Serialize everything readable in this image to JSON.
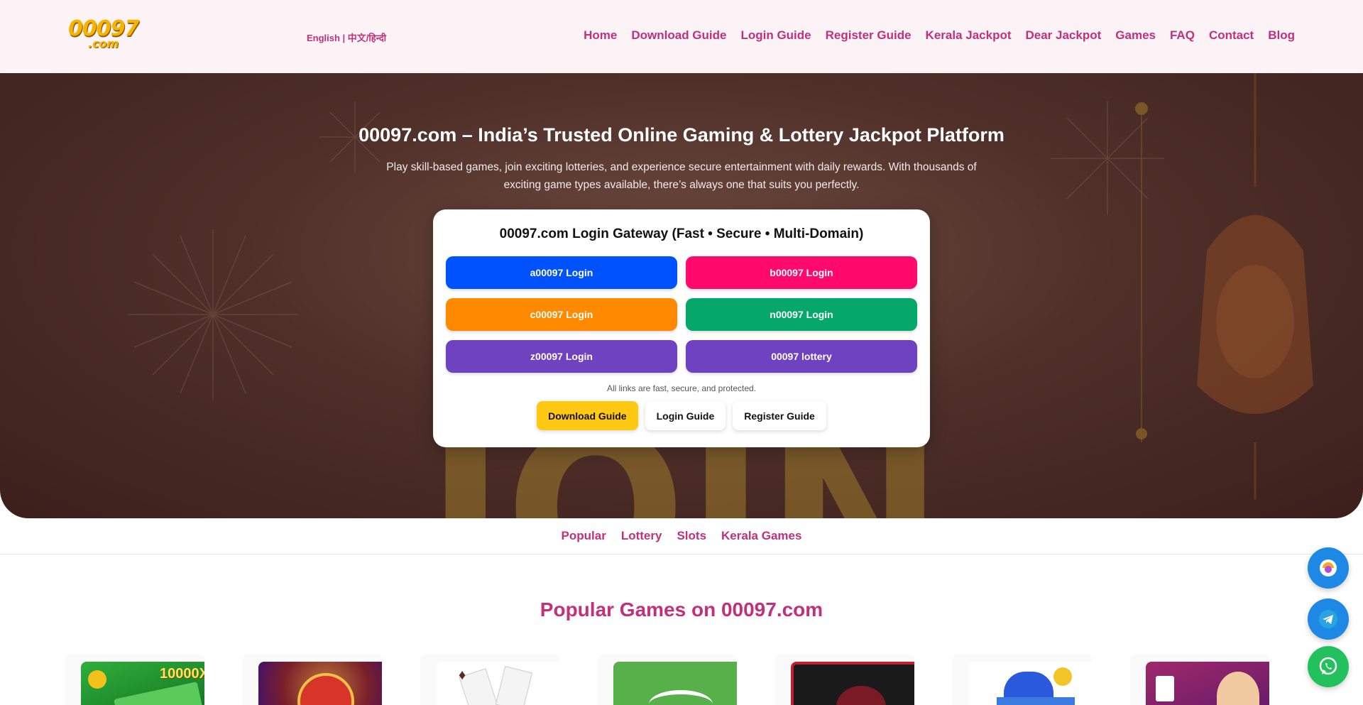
{
  "header": {
    "logo_text": "00097",
    "logo_sub": ".com",
    "language_label": " English | 中文/हिन्दी",
    "nav": [
      {
        "label": " Home"
      },
      {
        "label": " Download Guide"
      },
      {
        "label": " Login Guide"
      },
      {
        "label": " Register Guide"
      },
      {
        "label": " Kerala Jackpot"
      },
      {
        "label": " Dear Jackpot"
      },
      {
        "label": " Games"
      },
      {
        "label": " FAQ"
      },
      {
        "label": " Contact"
      },
      {
        "label": "Blog"
      }
    ]
  },
  "hero": {
    "title": "00097.com – India’s Trusted Online Gaming & Lottery Jackpot Platform",
    "description": "Play skill-based games, join exciting lotteries, and experience secure entertainment with daily rewards. With thousands of exciting game types available, there’s always one that suits you perfectly."
  },
  "login_card": {
    "title": " 00097.com Login Gateway (Fast • Secure • Multi-Domain)",
    "buttons": [
      {
        "label": "a00097 Login",
        "color": "#0052ff"
      },
      {
        "label": "b00097 Login",
        "color": "#ff0a6c"
      },
      {
        "label": "c00097 Login",
        "color": "#ff8a00"
      },
      {
        "label": "n00097 Login",
        "color": "#05a86a"
      },
      {
        "label": "z00097 Login",
        "color": "#6f42c1"
      },
      {
        "label": "00097 lottery",
        "color": "#6f42c1"
      }
    ],
    "note": " All links are fast, secure, and protected.",
    "guides": [
      {
        "label": " Download Guide"
      },
      {
        "label": " Login Guide"
      },
      {
        "label": " Register Guide"
      }
    ]
  },
  "tabs": [
    {
      "label": "Popular"
    },
    {
      "label": "Lottery"
    },
    {
      "label": "Slots"
    },
    {
      "label": "Kerala Games"
    }
  ],
  "section": {
    "title": " Popular Games on 00097.com"
  },
  "games": [
    {
      "label": "10000X"
    },
    {
      "label": ""
    },
    {
      "label": ""
    },
    {
      "label": ""
    },
    {
      "label": ""
    },
    {
      "label": ""
    },
    {
      "label": ""
    }
  ],
  "colors": {
    "accent": "#c2307a",
    "header_bg": "#fcf3f6",
    "gold": "#ffc812"
  },
  "floating": [
    {
      "icon": "chat-support-icon"
    },
    {
      "icon": "telegram-icon"
    },
    {
      "icon": "whatsapp-icon"
    }
  ]
}
